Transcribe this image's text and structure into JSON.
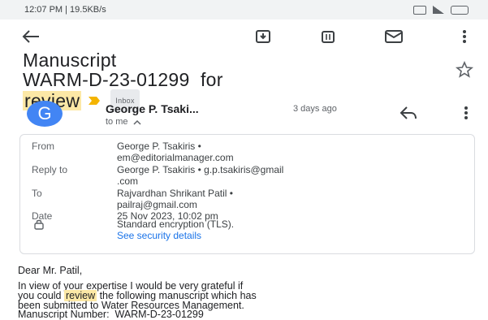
{
  "status_bar": {
    "time_speed": "12:07 PM | 19.5KB/s"
  },
  "toolbar": {
    "back_icon": "arrow-left-icon",
    "archive_icon": "archive-icon",
    "delete_icon": "trash-icon",
    "mark_unread_icon": "mail-icon",
    "more_icon": "more-vertical-icon"
  },
  "email": {
    "subject_line1": "Manuscript",
    "subject_line2": "WARM-D-23-01299  for",
    "subject_word_highlight": "review",
    "label": "Inbox",
    "sender_initial": "G",
    "sender_name": "George P. Tsaki...",
    "sender_time": "3 days ago",
    "to": "to me",
    "details": {
      "from_label": "From",
      "from_value_1": "George P. Tsakiris •",
      "from_value_2": "em@editorialmanager.com",
      "reply_label": "Reply to",
      "reply_value_1": "George P. Tsakiris • g.p.tsakiris@gmail",
      "reply_value_2": ".com",
      "to_label": "To",
      "to_value_1": "Rajvardhan Shrikant Patil •",
      "to_value_2": "pailraj@gmail.com",
      "date_label": "Date",
      "date_value": "25 Nov 2023, 10:02 pm",
      "encryption": "Standard encryption (TLS).",
      "security_link": "See security details"
    },
    "body": {
      "greeting": "Dear Mr. Patil,",
      "line1": "In view of your expertise I would be very grateful if",
      "line2_prefix": "you could ",
      "line2_highlight": "review",
      "line2_suffix": " the following manuscript which has",
      "line3": "been submitted to Water Resources Management.",
      "line4": "Manuscript Number:  WARM-D-23-01299"
    }
  },
  "colors": {
    "avatar": "#4285f4",
    "highlight": "#fce8a6",
    "link": "#1a73e8",
    "importance": "#f4b400"
  }
}
